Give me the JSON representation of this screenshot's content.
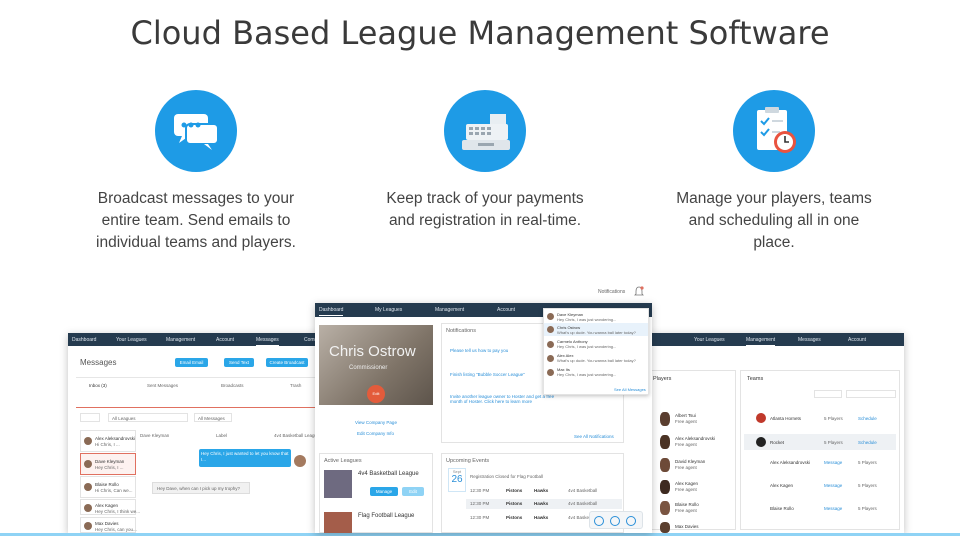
{
  "page": {
    "title": "Cloud Based League Management Software"
  },
  "features": [
    {
      "icon": "chat-bubbles-icon",
      "text_lines": [
        "Broadcast messages to your",
        "entire team. Send emails to",
        "individual teams and players."
      ]
    },
    {
      "icon": "cash-register-icon",
      "text_lines": [
        "Keep track of your payments",
        "and registration in real-time."
      ]
    },
    {
      "icon": "clipboard-clock-icon",
      "text_lines": [
        "Manage your players, teams",
        "and scheduling all in one",
        "place."
      ]
    }
  ],
  "colors": {
    "accent": "#1e9be6",
    "nav": "#253b4f",
    "link": "#2a8fd8",
    "alert": "#e07060"
  },
  "left_screen": {
    "nav": [
      "Dashboard",
      "Your Leagues",
      "Management",
      "Account",
      "Messages",
      "Comm"
    ],
    "active_nav": "Messages",
    "heading": "Messages",
    "buttons": [
      "Email Email",
      "Send Text",
      "Create Broadcast"
    ],
    "tabs": [
      "Inbox (3)",
      "Sent Messages",
      "Broadcasts",
      "Trash"
    ],
    "filters": [
      "All Leagues",
      "All Messages"
    ],
    "contacts": [
      {
        "name": "Alex Aleksandrovski",
        "preview": "Hi Chris, I ..."
      },
      {
        "name": "Dave Kleyman",
        "preview": "Hey Chris, I ..."
      },
      {
        "name": "Blaise Rollo",
        "preview": "Hi Chris, Can we..."
      },
      {
        "name": "Alex Kagen",
        "preview": "Hey Chris, I think we..."
      },
      {
        "name": "Max Davies",
        "preview": "Hey Chris, can you..."
      }
    ],
    "thread_from": "Dave Kleyman",
    "thread_label": "Label",
    "thread_league": "4v4 Basketball League",
    "bubble_1": "Hey Chris, I just wanted to let you know that I...",
    "bubble_2": "Hey Dave, when can I pick up my trophy?"
  },
  "center_screen": {
    "notifications_label": "Notifications",
    "nav": [
      "Dashboard",
      "My Leagues",
      "Management",
      "Account"
    ],
    "active_nav": "Dashboard",
    "profile_name": "Chris Ostrow",
    "profile_role": "Commissioner",
    "edit_badge": "Edit Photo",
    "links": [
      "View Company Page",
      "Edit Company Info"
    ],
    "notif_heading": "Notifications",
    "notif_items": [
      "Please tell us how to pay you",
      "Finish listing \"Bubble Soccer League\"",
      "Invite another league owner to Hoster and get a free month of Hoster. Click here to learn more"
    ],
    "see_all": "See All Notifications",
    "active_leagues_heading": "Active Leagues",
    "leagues": [
      {
        "name": "4v4 Basketball League",
        "manage": "Manage",
        "edit": "Edit"
      },
      {
        "name": "Flag Football League",
        "manage": "Manage",
        "edit": "Edit"
      }
    ],
    "events_heading": "Upcoming Events",
    "event_date_month": "Sept",
    "event_date_day": "26",
    "event_banner": "Registration Closed for Flag Football",
    "events": [
      {
        "time": "12:30 PM",
        "home": "Pistons",
        "away": "Hawks",
        "league": "4v4 Basketball"
      },
      {
        "time": "12:30 PM",
        "home": "Pistons",
        "away": "Hawks",
        "league": "4v4 Basketball"
      },
      {
        "time": "12:30 PM",
        "home": "Pistons",
        "away": "Hawks",
        "league": "4v4 Basketball"
      }
    ],
    "popup_messages": [
      {
        "name": "Dave Kleyman",
        "text": "Hey Chris, I was just wondering..."
      },
      {
        "name": "Chris Ostrow",
        "text": "What's up dude. You wanna ball later today?"
      },
      {
        "name": "Carmelo Anthony",
        "text": "Hey Chris, I was just wondering..."
      },
      {
        "name": "Alex Alex",
        "text": "What's up dude. You wanna ball later today?"
      },
      {
        "name": "Max Its",
        "text": "Hey Chris, I was just wondering..."
      }
    ],
    "see_all_messages": "See All Messages"
  },
  "right_screen": {
    "nav": [
      "Your Leagues",
      "Management",
      "Messages",
      "Account"
    ],
    "active_nav": "Management",
    "players_heading": "Players",
    "teams_heading": "Teams",
    "players": [
      {
        "name": "Albert Tsui",
        "role": "Free agent"
      },
      {
        "name": "Alex Aleksandrovski",
        "role": "Free agent"
      },
      {
        "name": "David Kleyman",
        "role": "Free agent"
      },
      {
        "name": "Alex Kagen",
        "role": "Free agent"
      },
      {
        "name": "Blaise Rollo",
        "role": "Free agent"
      },
      {
        "name": "Max Davies",
        "role": "Free agent"
      }
    ],
    "teams": [
      {
        "name": "Atlanta Hornets",
        "count": "5 Players",
        "action": "Schedule"
      },
      {
        "name": "Rocket",
        "count": "5 Players",
        "action": "Schedule"
      }
    ],
    "team_members": [
      {
        "name": "Alex Aleksandrovski",
        "link": "Message",
        "count": "5 Players"
      },
      {
        "name": "Alex Kagen",
        "link": "Message",
        "count": "5 Players"
      },
      {
        "name": "Blaise Rollo",
        "link": "Message",
        "count": "5 Players"
      }
    ]
  }
}
